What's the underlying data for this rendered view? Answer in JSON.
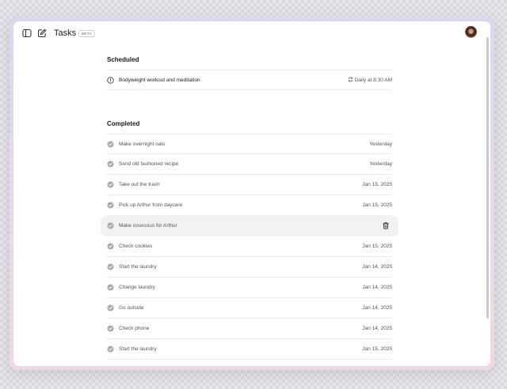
{
  "app": {
    "title": "Tasks",
    "badge": "BETA"
  },
  "scheduled": {
    "heading": "Scheduled",
    "items": [
      {
        "label": "Bodyweight workout and meditation",
        "schedule": "Daily at 8:30 AM"
      }
    ]
  },
  "completed": {
    "heading": "Completed",
    "items": [
      {
        "label": "Make overnight oats",
        "date": "Yesterday"
      },
      {
        "label": "Send old fashioned recipe",
        "date": "Yesterday"
      },
      {
        "label": "Take out the trash",
        "date": "Jan 15, 2025"
      },
      {
        "label": "Pick up Arthur from daycare",
        "date": "Jan 15, 2025"
      },
      {
        "label": "Make couscous for Arthur",
        "date": ""
      },
      {
        "label": "Check cookies",
        "date": "Jan 15, 2025"
      },
      {
        "label": "Start the laundry",
        "date": "Jan 14, 2025"
      },
      {
        "label": "Change laundry",
        "date": "Jan 14, 2025"
      },
      {
        "label": "Go outside",
        "date": "Jan 14, 2025"
      },
      {
        "label": "Check phone",
        "date": "Jan 14, 2025"
      },
      {
        "label": "Start the laundry",
        "date": "Jan 15, 2025"
      }
    ]
  },
  "icons": {
    "sidebar": "sidebar-toggle-icon",
    "compose": "compose-icon",
    "scheduled": "clock-alert-icon",
    "repeat": "repeat-icon",
    "done": "check-circle-icon",
    "delete": "trash-icon"
  },
  "colors": {
    "frame_top": "#dcd6f2",
    "frame_bottom": "#f1d8de",
    "check": "#a9a9ad",
    "highlight": "#f2f2f3"
  }
}
